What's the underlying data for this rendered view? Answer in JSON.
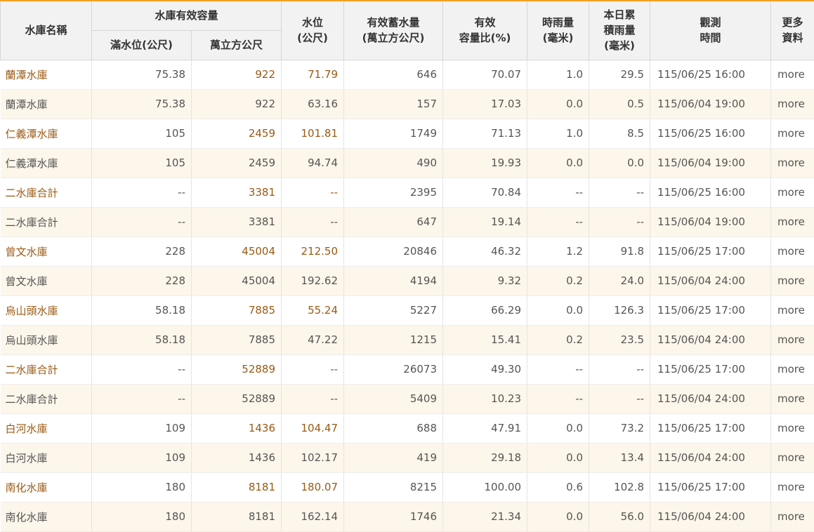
{
  "headers": {
    "name": "水庫名稱",
    "capacity_group": "水庫有效容量",
    "full_level": "滿水位(公尺)",
    "capacity": "萬立方公尺",
    "level_l1": "水位",
    "level_l2": "(公尺)",
    "storage_l1": "有效蓄水量",
    "storage_l2": "(萬立方公尺)",
    "pct_l1": "有效",
    "pct_l2": "容量比(%)",
    "rain_l1": "時雨量",
    "rain_l2": "(毫米)",
    "acc_l1": "本日累",
    "acc_l2": "積雨量",
    "acc_l3": "(毫米)",
    "time_l1": "觀測",
    "time_l2": "時間",
    "more_l1": "更多",
    "more_l2": "資料"
  },
  "rows": [
    {
      "name": "蘭潭水庫",
      "full": "75.38",
      "cap": "922",
      "lvl": "71.79",
      "eff": "646",
      "pct": "70.07",
      "rain": "1.0",
      "acc": "29.5",
      "time": "115/06/25 16:00",
      "more": "more"
    },
    {
      "name": "蘭潭水庫",
      "full": "75.38",
      "cap": "922",
      "lvl": "63.16",
      "eff": "157",
      "pct": "17.03",
      "rain": "0.0",
      "acc": "0.5",
      "time": "115/06/04 19:00",
      "more": "more"
    },
    {
      "name": "仁義潭水庫",
      "full": "105",
      "cap": "2459",
      "lvl": "101.81",
      "eff": "1749",
      "pct": "71.13",
      "rain": "1.0",
      "acc": "8.5",
      "time": "115/06/25 16:00",
      "more": "more"
    },
    {
      "name": "仁義潭水庫",
      "full": "105",
      "cap": "2459",
      "lvl": "94.74",
      "eff": "490",
      "pct": "19.93",
      "rain": "0.0",
      "acc": "0.0",
      "time": "115/06/04 19:00",
      "more": "more"
    },
    {
      "name": "二水庫合計",
      "full": "--",
      "cap": "3381",
      "lvl": "--",
      "eff": "2395",
      "pct": "70.84",
      "rain": "--",
      "acc": "--",
      "time": "115/06/25 16:00",
      "more": "more"
    },
    {
      "name": "二水庫合計",
      "full": "--",
      "cap": "3381",
      "lvl": "--",
      "eff": "647",
      "pct": "19.14",
      "rain": "--",
      "acc": "--",
      "time": "115/06/04 19:00",
      "more": "more"
    },
    {
      "name": "曾文水庫",
      "full": "228",
      "cap": "45004",
      "lvl": "212.50",
      "eff": "20846",
      "pct": "46.32",
      "rain": "1.2",
      "acc": "91.8",
      "time": "115/06/25 17:00",
      "more": "more"
    },
    {
      "name": "曾文水庫",
      "full": "228",
      "cap": "45004",
      "lvl": "192.62",
      "eff": "4194",
      "pct": "9.32",
      "rain": "0.2",
      "acc": "24.0",
      "time": "115/06/04 24:00",
      "more": "more"
    },
    {
      "name": "烏山頭水庫",
      "full": "58.18",
      "cap": "7885",
      "lvl": "55.24",
      "eff": "5227",
      "pct": "66.29",
      "rain": "0.0",
      "acc": "126.3",
      "time": "115/06/25 17:00",
      "more": "more"
    },
    {
      "name": "烏山頭水庫",
      "full": "58.18",
      "cap": "7885",
      "lvl": "47.22",
      "eff": "1215",
      "pct": "15.41",
      "rain": "0.2",
      "acc": "23.5",
      "time": "115/06/04 24:00",
      "more": "more"
    },
    {
      "name": "二水庫合計",
      "full": "--",
      "cap": "52889",
      "lvl": "--",
      "eff": "26073",
      "pct": "49.30",
      "rain": "--",
      "acc": "--",
      "time": "115/06/25 17:00",
      "more": "more"
    },
    {
      "name": "二水庫合計",
      "full": "--",
      "cap": "52889",
      "lvl": "--",
      "eff": "5409",
      "pct": "10.23",
      "rain": "--",
      "acc": "--",
      "time": "115/06/04 24:00",
      "more": "more"
    },
    {
      "name": "白河水庫",
      "full": "109",
      "cap": "1436",
      "lvl": "104.47",
      "eff": "688",
      "pct": "47.91",
      "rain": "0.0",
      "acc": "73.2",
      "time": "115/06/25 17:00",
      "more": "more"
    },
    {
      "name": "白河水庫",
      "full": "109",
      "cap": "1436",
      "lvl": "102.17",
      "eff": "419",
      "pct": "29.18",
      "rain": "0.0",
      "acc": "13.4",
      "time": "115/06/04 24:00",
      "more": "more"
    },
    {
      "name": "南化水庫",
      "full": "180",
      "cap": "8181",
      "lvl": "180.07",
      "eff": "8215",
      "pct": "100.00",
      "rain": "0.6",
      "acc": "102.8",
      "time": "115/06/25 17:00",
      "more": "more"
    },
    {
      "name": "南化水庫",
      "full": "180",
      "cap": "8181",
      "lvl": "162.14",
      "eff": "1746",
      "pct": "21.34",
      "rain": "0.0",
      "acc": "56.0",
      "time": "115/06/04 24:00",
      "more": "more"
    }
  ]
}
